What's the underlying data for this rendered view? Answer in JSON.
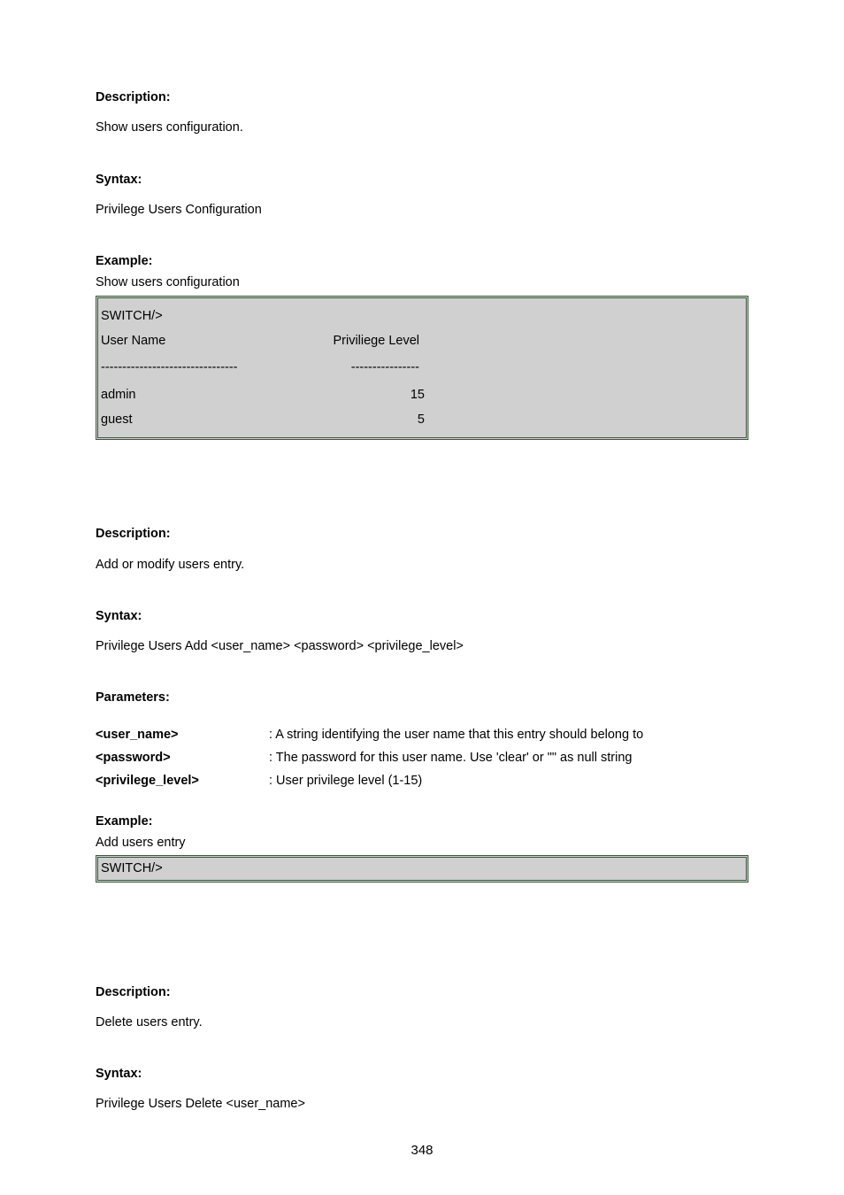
{
  "section1": {
    "descLabel": "Description:",
    "descText": "Show users configuration.",
    "syntaxLabel": "Syntax:",
    "syntaxText": "Privilege Users Configuration",
    "exampleLabel": "Example:",
    "exampleText": "Show users configuration",
    "box": {
      "prompt": "SWITCH/>",
      "header": {
        "c1": "User Name",
        "c2": "Priviliege Level"
      },
      "dash1": "--------------------------------",
      "dash2": "----------------",
      "rows": [
        {
          "name": "admin",
          "level": "15"
        },
        {
          "name": "guest",
          "level": "5"
        }
      ]
    }
  },
  "section2": {
    "descLabel": "Description:",
    "descText": "Add or modify users entry.",
    "syntaxLabel": "Syntax:",
    "syntaxText": "Privilege Users Add <user_name> <password> <privilege_level>",
    "paramLabel": "Parameters:",
    "params": [
      {
        "key": "<user_name>",
        "desc": ": A string identifying the user name that this entry should belong to"
      },
      {
        "key": "<password>",
        "desc": ": The password for this user name. Use 'clear' or \"\" as null string"
      },
      {
        "key": "<privilege_level>",
        "desc": ": User privilege level (1-15)"
      }
    ],
    "exampleLabel": "Example:",
    "exampleText": "Add users entry",
    "boxPrompt": "SWITCH/>"
  },
  "section3": {
    "descLabel": "Description:",
    "descText": "Delete users entry.",
    "syntaxLabel": "Syntax:",
    "syntaxText": "Privilege Users Delete <user_name>"
  },
  "pageNumber": "348"
}
